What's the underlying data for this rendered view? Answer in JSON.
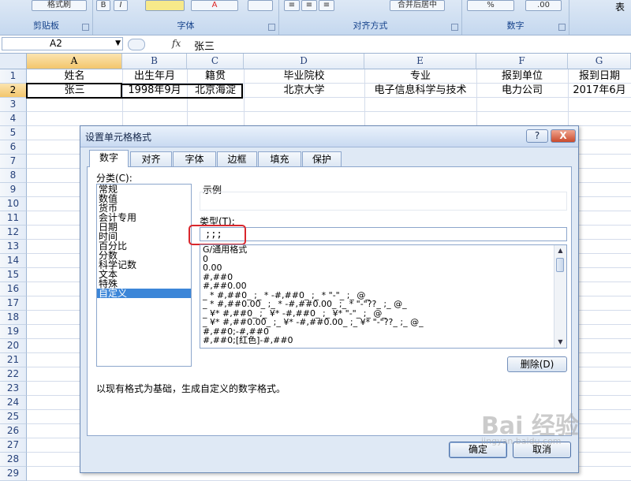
{
  "ribbon": {
    "groups": [
      {
        "label": "剪贴板"
      },
      {
        "label": "字体"
      },
      {
        "label": "对齐方式"
      },
      {
        "label": "数字"
      }
    ],
    "format_painter_label": "格式刷",
    "merge_label": "合并后居中",
    "right_edge_label": "表"
  },
  "formula_bar": {
    "name_box": "A2",
    "fx_label": "fx",
    "value": "张三"
  },
  "sheet": {
    "columns": [
      "A",
      "B",
      "C",
      "D",
      "E",
      "F",
      "G"
    ],
    "rows": [
      "1",
      "2",
      "3",
      "4",
      "5",
      "6",
      "7",
      "8",
      "9",
      "10",
      "11",
      "12",
      "13",
      "14",
      "15",
      "16",
      "17",
      "18",
      "19",
      "20",
      "21",
      "22",
      "23",
      "24",
      "25",
      "26",
      "27",
      "28",
      "29"
    ],
    "row1": [
      "姓名",
      "出生年月",
      "籍贯",
      "毕业院校",
      "专业",
      "报到单位",
      "报到日期"
    ],
    "row2": [
      "张三",
      "1998年9月",
      "北京海淀",
      "北京大学",
      "电子信息科学与技术",
      "电力公司",
      "2017年6月"
    ]
  },
  "dialog": {
    "title": "设置单元格格式",
    "help_label": "?",
    "close_label": "X",
    "tabs": [
      "数字",
      "对齐",
      "字体",
      "边框",
      "填充",
      "保护"
    ],
    "category_label": "分类(C):",
    "categories": [
      "常规",
      "数值",
      "货币",
      "会计专用",
      "日期",
      "时间",
      "百分比",
      "分数",
      "科学记数",
      "文本",
      "特殊",
      "自定义"
    ],
    "selected_category": "自定义",
    "sample_label": "示例",
    "type_label": "类型(T):",
    "type_value": ";;;",
    "formats": [
      "G/通用格式",
      "0",
      "0.00",
      "#,##0",
      "#,##0.00",
      "_ * #,##0_ ;_ * -#,##0_ ;_ * \"-\"_ ;_ @_",
      "_ * #,##0.00_ ;_ * -#,##0.00_ ;_ * \"-\"??_ ;_ @_",
      "_ ¥* #,##0_ ;_ ¥* -#,##0_ ;_ ¥* \"-\"_ ;_ @_",
      "_ ¥* #,##0.00_ ;_ ¥* -#,##0.00_ ;_ ¥* \"-\"??_ ;_ @_",
      "#,##0;-#,##0",
      "#,##0;[红色]-#,##0"
    ],
    "delete_label": "删除(D)",
    "description": "以现有格式为基础，生成自定义的数字格式。",
    "ok_label": "确定",
    "cancel_label": "取消"
  },
  "watermark": {
    "brand": "Bai 经验",
    "url": "jingyan.baidu.com"
  },
  "colors": {
    "selection": "#3c86d8",
    "highlight_marker": "#d9262c",
    "header_active": "#f3c66c"
  }
}
